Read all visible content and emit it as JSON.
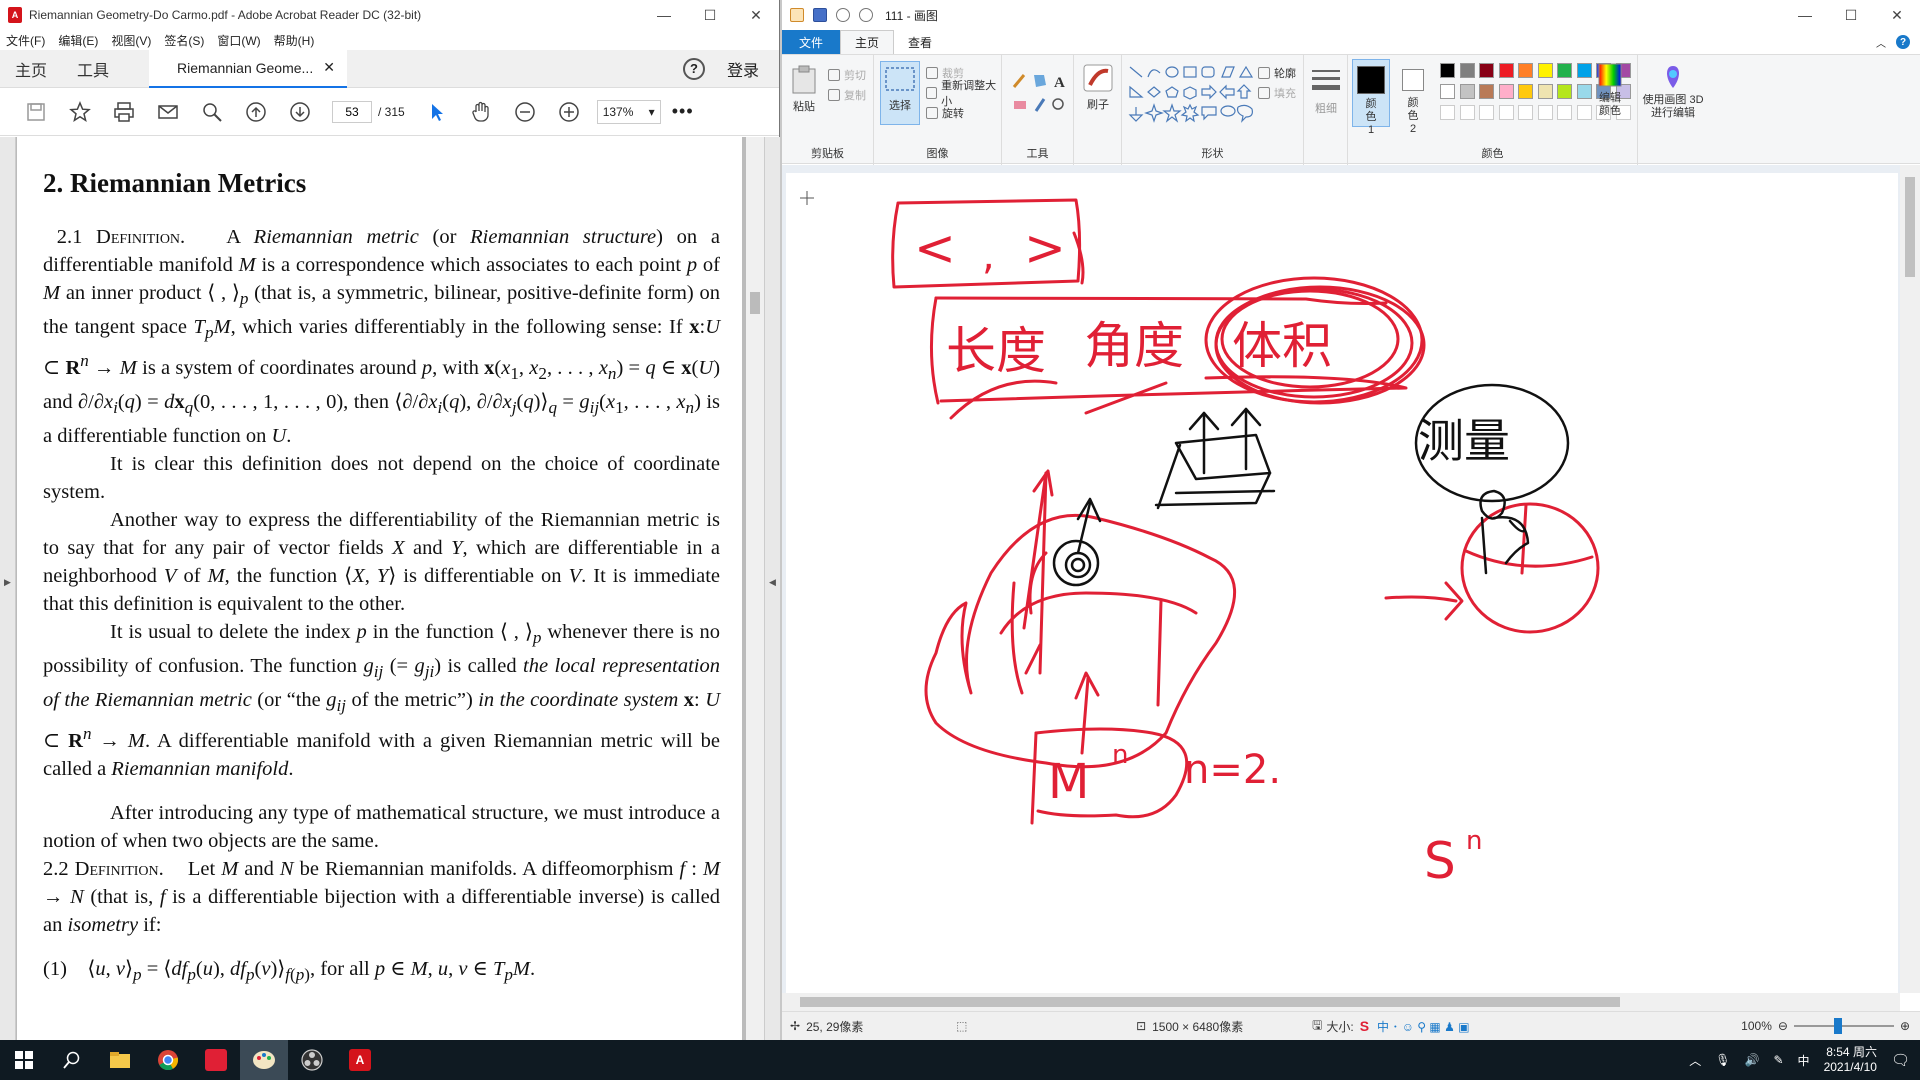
{
  "acrobat": {
    "title": "Riemannian Geometry-Do Carmo.pdf - Adobe Acrobat Reader DC (32-bit)",
    "menu": [
      "文件(F)",
      "编辑(E)",
      "视图(V)",
      "签名(S)",
      "窗口(W)",
      "帮助(H)"
    ],
    "nav_home": "主页",
    "nav_tools": "工具",
    "doc_tab": "Riemannian Geome...",
    "login": "登录",
    "page_current": "53",
    "page_total": "/ 315",
    "zoom": "137%",
    "document": {
      "heading": "2. Riemannian Metrics",
      "def1_label": "2.1 Definition.",
      "p1": "A <i>Riemannian metric</i> (or <i>Riemannian structure</i>) on a differentiable manifold <i>M</i> is a correspondence which associates to each point <i>p</i> of <i>M</i> an inner product ⟨ , ⟩<sub><i>p</i></sub> (that is, a symmetric, bilinear, positive-definite form) on the tangent space <i>T<sub>p</sub>M</i>, which varies differentiably in the following sense: If <b>x</b>:<i>U</i> ⊂ <b>R</b><sup><i>n</i></sup> → <i>M</i> is a system of coordinates around <i>p</i>, with <b>x</b>(<i>x</i><sub>1</sub>, <i>x</i><sub>2</sub>, . . . , <i>x<sub>n</sub></i>) = <i>q</i> ∈ <b>x</b>(<i>U</i>) and ∂/∂<i>x<sub>i</sub></i>(<i>q</i>) = <i>d</i><b>x</b><sub><i>q</i></sub>(0, . . . , 1, . . . , 0), then ⟨∂/∂<i>x<sub>i</sub></i>(<i>q</i>), ∂/∂<i>x<sub>j</sub></i>(<i>q</i>)⟩<sub><i>q</i></sub> = <i>g<sub>ij</sub></i>(<i>x</i><sub>1</sub>, . . . , <i>x<sub>n</sub></i>) is a differentiable function on <i>U</i>.",
      "p2": "It is clear this definition does not depend on the choice of coordinate system.",
      "p3": "Another way to express the differentiability of the Riemannian metric is to say that for any pair of vector fields <i>X</i> and <i>Y</i>, which are differentiable in a neighborhood <i>V</i> of <i>M</i>, the function ⟨<i>X</i>, <i>Y</i>⟩ is differentiable on <i>V</i>. It is immediate that this definition is equivalent to the other.",
      "p4": "It is usual to delete the index <i>p</i> in the function ⟨ , ⟩<sub><i>p</i></sub> whenever there is no possibility of confusion. The function <i>g<sub>ij</sub></i> (= <i>g<sub>ji</sub></i>) is called <i>the local representation of the Riemannian metric</i> (or “the <i>g<sub>ij</sub></i> of the metric”) <i>in the coordinate system</i> <b>x</b>: <i>U</i> ⊂ <b>R</b><sup><i>n</i></sup> → <i>M</i>. A differentiable manifold with a given Riemannian metric will be called a <i>Riemannian manifold</i>.",
      "p5": "After introducing any type of mathematical structure, we must introduce a notion of when two objects are the same.",
      "def2_label": "2.2 Definition.",
      "p6": "Let <i>M</i> and <i>N</i> be Riemannian manifolds. A diffeomorphism <i>f</i> : <i>M</i> → <i>N</i> (that is, <i>f</i> is a differentiable bijection with a differentiable inverse) is called an <i>isometry</i> if:",
      "eq1": "(1)&nbsp;&nbsp;&nbsp;&nbsp;⟨<i>u</i>, <i>v</i>⟩<sub><i>p</i></sub> = ⟨<i>df<sub>p</sub></i>(<i>u</i>), <i>df<sub>p</sub></i>(<i>v</i>)⟩<sub><i>f</i>(<i>p</i>)</sub>, for all <i>p</i> ∈ <i>M</i>, <i>u</i>, <i>v</i> ∈ <i>T<sub>p</sub>M</i>."
    }
  },
  "paint": {
    "title": "111 - 画图",
    "tabs": [
      "文件",
      "主页",
      "查看"
    ],
    "clipboard": {
      "paste": "粘贴",
      "cut": "剪切",
      "copy": "复制",
      "label": "剪贴板"
    },
    "image": {
      "select": "选择",
      "crop": "裁剪",
      "resize": "重新调整大小",
      "rotate": "旋转",
      "label": "图像"
    },
    "tools": {
      "label": "工具",
      "brush": "刷子"
    },
    "shapes": {
      "outline": "轮廓",
      "fill": "填充",
      "label": "形状"
    },
    "size": "粗细",
    "color1": "颜色 1",
    "color2": "颜色 2",
    "edit_colors": "编辑颜色",
    "paint3d": "使用画图 3D 进行编辑",
    "colors_label": "颜色",
    "palette": [
      "#000000",
      "#7f7f7f",
      "#880015",
      "#ed1c24",
      "#ff7f27",
      "#fff200",
      "#22b14c",
      "#00a2e8",
      "#3f48cc",
      "#a349a4",
      "#ffffff",
      "#c3c3c3",
      "#b97a57",
      "#ffaec9",
      "#ffc90e",
      "#efe4b0",
      "#b5e61d",
      "#99d9ea",
      "#7092be",
      "#c8bfe7"
    ],
    "status": {
      "cursor": "25, 29像素",
      "dimensions": "1500 × 6480像素",
      "size_label": "大小:",
      "zoom": "100%"
    },
    "handwriting": [
      "<",
      ",",
      ">",
      "长度",
      "角度",
      "体积",
      "测量",
      "M",
      "n",
      "S",
      "n",
      "n=2."
    ]
  },
  "taskbar": {
    "time": "8:54 周六",
    "date": "2021/4/10",
    "ime": "中"
  },
  "colors": {
    "ink_red": "#e02035",
    "ink_black": "#111111",
    "accent": "#1979ca",
    "acrobat_red": "#d4141b"
  }
}
